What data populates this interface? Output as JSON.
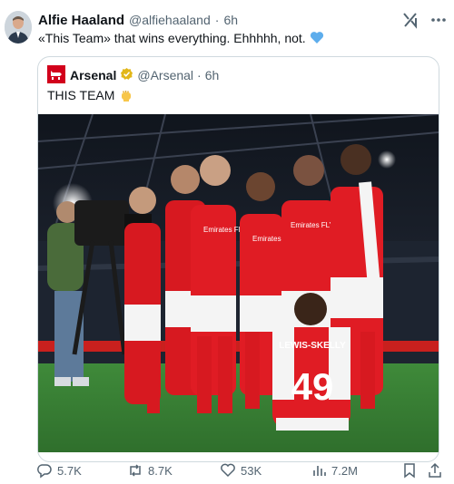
{
  "author": {
    "name": "Alfie Haaland",
    "handle": "@alfiehaaland",
    "separator": "·",
    "time": "6h"
  },
  "tweet": {
    "text": "«This Team» that wins everything. Ehhhhh, not.",
    "emoji_icon": "blue-heart-icon"
  },
  "quoted": {
    "name": "Arsenal",
    "handle": "@Arsenal",
    "separator": "·",
    "time": "6h",
    "verified_color": "#e2b719",
    "text": "THIS TEAM",
    "emoji_icon": "raised-fist-icon",
    "brand_color": "#d2001b"
  },
  "photo": {
    "jerseys": [
      {
        "text": "Emirates FLY BETTER"
      },
      {
        "text": "Emirates FLY BETTER"
      },
      {
        "text": "Emirates FLY BETTER"
      }
    ],
    "back_name": "LEWIS-SKELLY",
    "back_number": "49"
  },
  "actions": {
    "replies": "5.7K",
    "reposts": "8.7K",
    "likes": "53K",
    "views": "7.2M"
  },
  "icons": {
    "reply": "reply-icon",
    "repost": "repost-icon",
    "like": "heart-icon",
    "views": "views-icon",
    "bookmark": "bookmark-icon",
    "share": "share-icon",
    "grok": "grok-icon",
    "more": "more-icon"
  }
}
